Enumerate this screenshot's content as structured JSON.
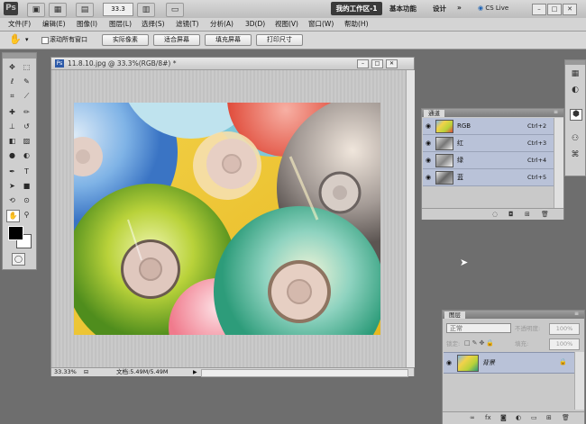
{
  "app": {
    "logo": "Ps",
    "zoom_level": "33.3",
    "workspace_active": "我的工作区-1",
    "workspace_basic": "基本功能",
    "workspace_design": "设计",
    "more": "»",
    "cs_live": "CS Live",
    "window_buttons": [
      "–",
      "□",
      "✕"
    ]
  },
  "menu": [
    "文件(F)",
    "编辑(E)",
    "图像(I)",
    "图层(L)",
    "选择(S)",
    "滤镜(T)",
    "分析(A)",
    "3D(D)",
    "视图(V)",
    "窗口(W)",
    "帮助(H)"
  ],
  "options": {
    "scroll_all_windows": "滚动所有窗口",
    "buttons": [
      "实际像素",
      "适合屏幕",
      "填充屏幕",
      "打印尺寸"
    ]
  },
  "document": {
    "title": "11.8.10.jpg @ 33.3%(RGB/8#) *",
    "zoom": "33.33%",
    "doc_info": "文档:5.49M/5.49M"
  },
  "channels": {
    "tab": "通道",
    "rows": [
      {
        "name": "RGB",
        "shortcut": "Ctrl+2"
      },
      {
        "name": "红",
        "shortcut": "Ctrl+3"
      },
      {
        "name": "绿",
        "shortcut": "Ctrl+4"
      },
      {
        "name": "蓝",
        "shortcut": "Ctrl+5"
      }
    ]
  },
  "layers": {
    "tab": "图层",
    "blend_mode": "正常",
    "opacity_label": "不透明度:",
    "opacity_value": "100%",
    "lock_label": "锁定:",
    "fill_label": "填充:",
    "fill_value": "100%",
    "layer_name": "背景"
  },
  "colors": {
    "foreground": "#000000",
    "background": "#ffffff",
    "selection": "#b9c2d8"
  }
}
